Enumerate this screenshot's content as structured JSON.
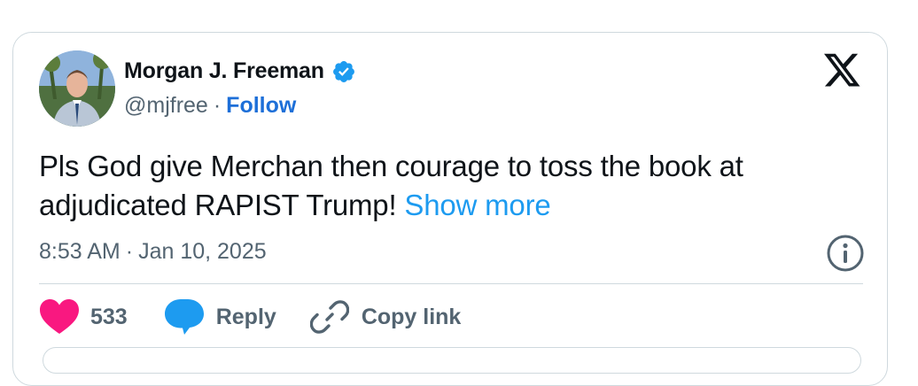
{
  "author": {
    "name": "Morgan J. Freeman",
    "handle": "@mjfree",
    "separator": "·",
    "follow_label": "Follow"
  },
  "tweet": {
    "text": "Pls God give Merchan then courage to toss the book at adjudicated RAPIST Trump! ",
    "show_more_label": "Show more"
  },
  "meta": {
    "time": "8:53 AM",
    "separator": "·",
    "date": "Jan 10, 2025"
  },
  "actions": {
    "like_count": "533",
    "reply_label": "Reply",
    "copy_link_label": "Copy link"
  },
  "colors": {
    "like": "#f91880",
    "reply": "#1d9bf0",
    "verified": "#1d9bf0",
    "follow": "#1d6fd8",
    "muted": "#536471"
  },
  "icons": {
    "verified": "verified-badge-icon",
    "platform": "x-logo-icon",
    "info": "info-icon",
    "like": "heart-icon",
    "reply": "speech-bubble-icon",
    "copy": "link-icon"
  }
}
